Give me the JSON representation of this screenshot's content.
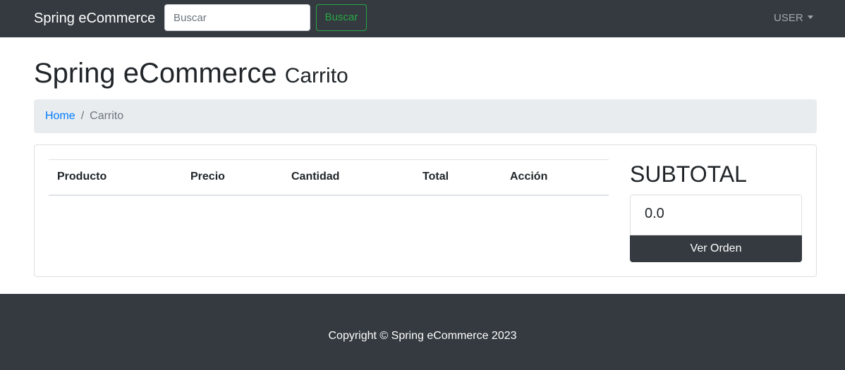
{
  "navbar": {
    "brand": "Spring eCommerce",
    "search_placeholder": "Buscar",
    "search_value": "",
    "search_button": "Buscar",
    "user_menu": "USER"
  },
  "page": {
    "title": "Spring eCommerce",
    "subtitle": "Carrito"
  },
  "breadcrumb": {
    "home": "Home",
    "separator": "/",
    "current": "Carrito"
  },
  "cart": {
    "columns": [
      "Producto",
      "Precio",
      "Cantidad",
      "Total",
      "Acción"
    ],
    "rows": []
  },
  "summary": {
    "title": "SUBTOTAL",
    "value": "0.0",
    "button": "Ver Orden"
  },
  "footer": {
    "copyright": "Copyright © Spring eCommerce 2023"
  },
  "colors": {
    "navbar_bg": "#343a40",
    "success": "#28a745",
    "link": "#007bff",
    "breadcrumb_bg": "#e9ecef"
  }
}
